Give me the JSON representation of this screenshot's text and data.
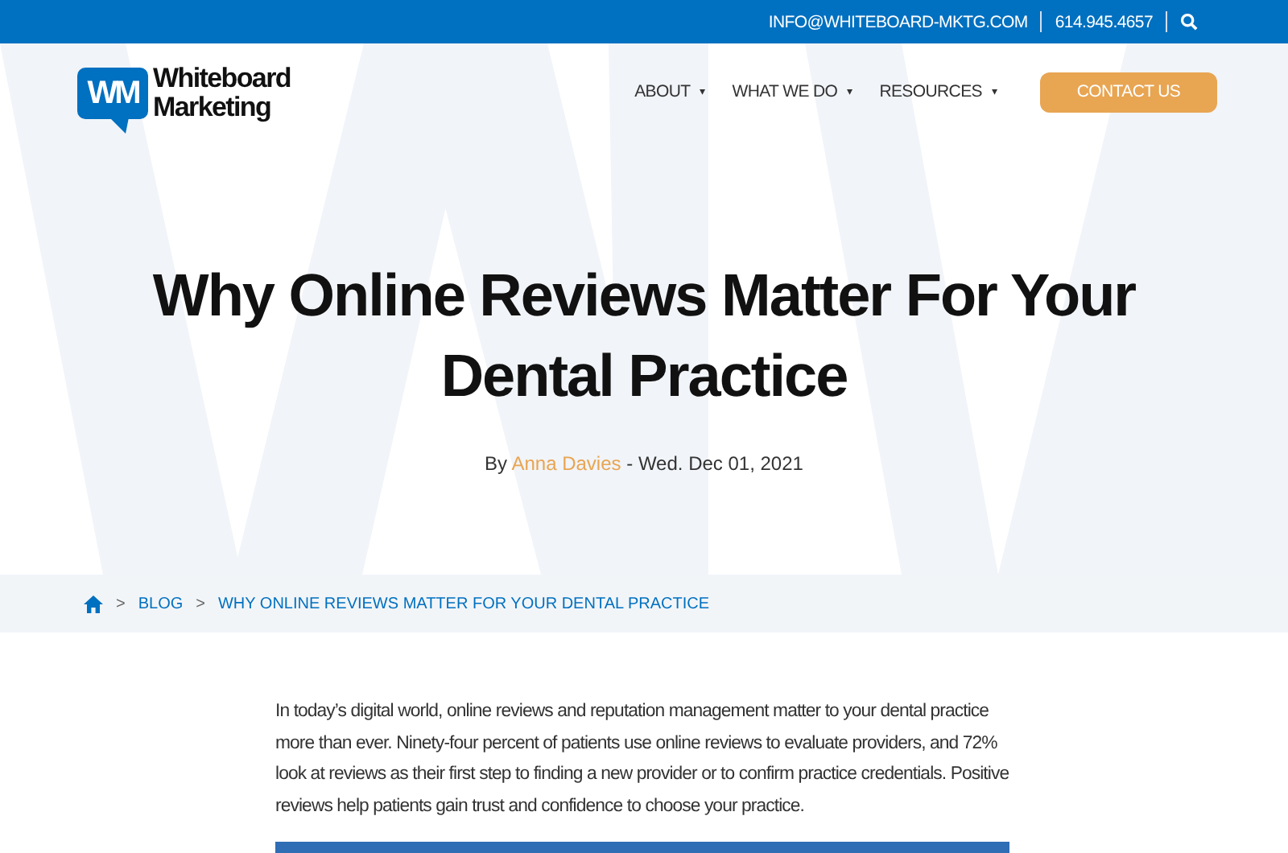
{
  "top_bar": {
    "email": "INFO@WHITEBOARD-MKTG.COM",
    "phone": "614.945.4657"
  },
  "logo": {
    "mark": "WM",
    "name_line_1": "Whiteboard",
    "name_line_2": "Marketing"
  },
  "nav": [
    {
      "label": "ABOUT",
      "caret": "▾"
    },
    {
      "label": "WHAT WE DO",
      "caret": "▾"
    },
    {
      "label": "RESOURCES",
      "caret": "▾"
    }
  ],
  "cta": "CONTACT US",
  "hero": {
    "title": "Why Online Reviews Matter For Your Dental Practice",
    "by": "By",
    "author": "Anna Davies",
    "date": "- Wed. Dec 01, 2021"
  },
  "breadcrumb": [
    {
      "label": "BLOG",
      "separator": ">"
    },
    {
      "label": "WHY ONLINE REVIEWS MATTER FOR YOUR DENTAL PRACTICE",
      "separator": ">"
    }
  ],
  "article": {
    "paragraph": "In today’s digital world, online reviews and reputation management matter to your dental practice more than ever. Ninety-four percent of patients use online reviews to evaluate providers, and 72% look at reviews as their first step to finding a new provider or to confirm practice credentials. Positive reviews help patients gain trust and confidence to choose your practice."
  }
}
